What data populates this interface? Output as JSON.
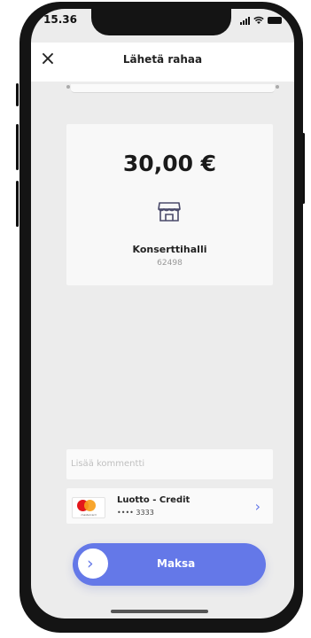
{
  "status": {
    "time": "15.36"
  },
  "header": {
    "title": "Lähetä rahaa",
    "close_icon": "close-icon"
  },
  "payment": {
    "amount": "30,00 €",
    "merchant_icon": "store-icon",
    "merchant_name": "Konserttihalli",
    "merchant_id": "62498"
  },
  "comment": {
    "placeholder": "Lisää kommentti"
  },
  "card": {
    "brand_text": "mastercard",
    "name": "Luotto - Credit",
    "number": "•••• 3333",
    "chevron_icon": "chevron-right-icon"
  },
  "pay_button": {
    "label": "Maksa",
    "icon": "chevron-right-icon"
  },
  "colors": {
    "accent": "#6478e8",
    "background": "#ececec"
  }
}
